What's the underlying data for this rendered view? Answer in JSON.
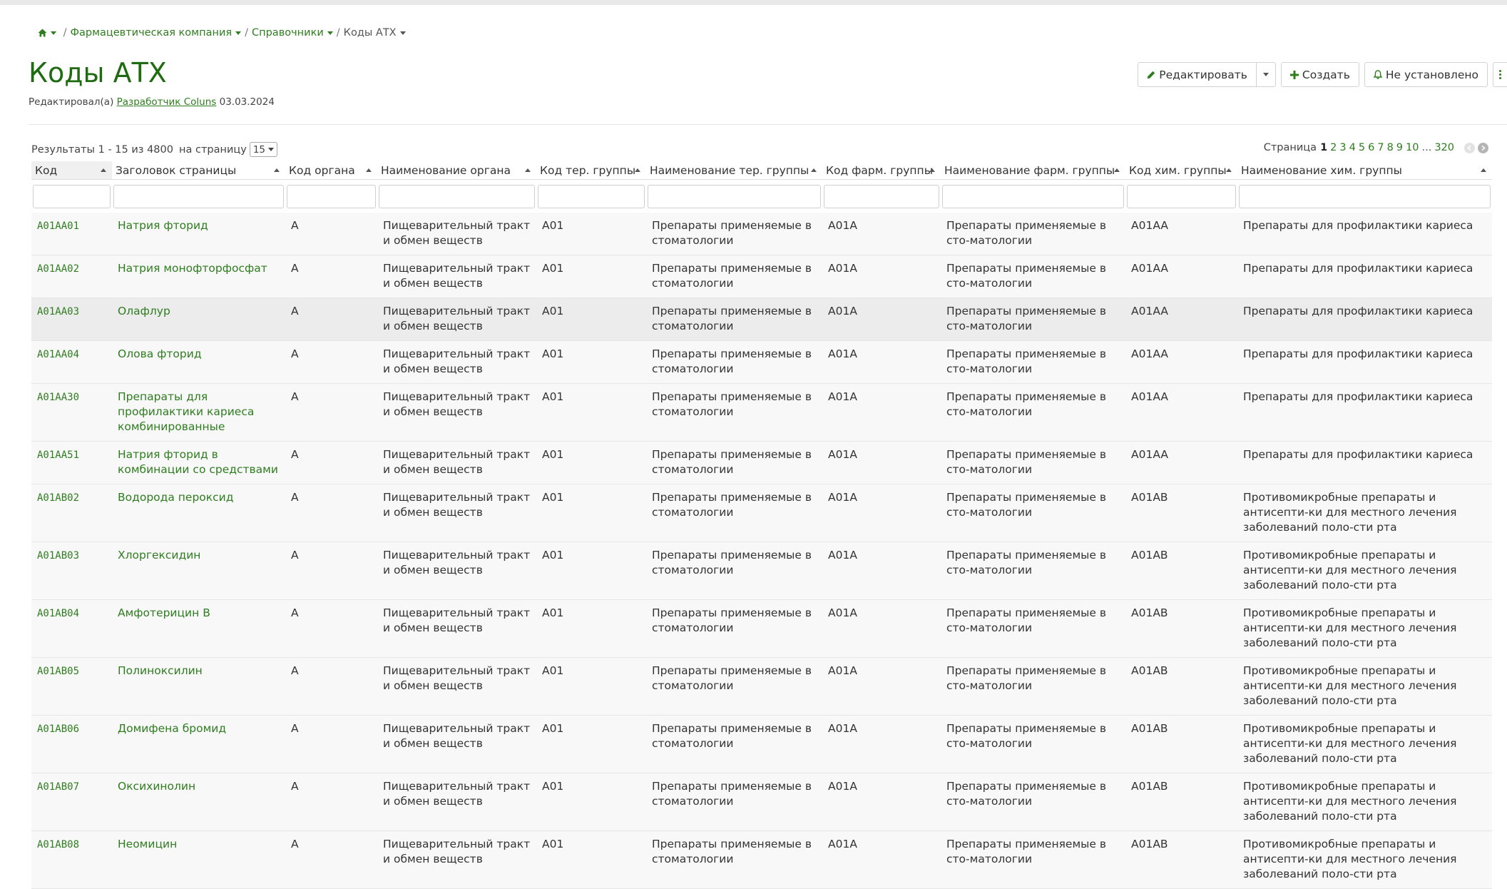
{
  "breadcrumb": {
    "items": [
      "Фармацевтическая компания",
      "Справочники"
    ],
    "current": "Коды АТХ",
    "separator": "/"
  },
  "page": {
    "title": "Коды АТХ",
    "edited_by_label": "Редактировал(а)",
    "edited_by_author": "Разработчик Coluns",
    "edited_date": "03.03.2024"
  },
  "actions": {
    "edit_label": "Редактировать",
    "create_label": "Создать",
    "notify_label": "Не установлено"
  },
  "results": {
    "summary": "Результаты 1 - 15 из 4800",
    "per_page_label": "на страницу",
    "per_page_value": "15"
  },
  "pagination": {
    "label": "Страница",
    "current": "1",
    "pages": [
      "2",
      "3",
      "4",
      "5",
      "6",
      "7",
      "8",
      "9",
      "10"
    ],
    "ellipsis": "...",
    "last": "320"
  },
  "table": {
    "columns": [
      "Код",
      "Заголовок страницы",
      "Код органа",
      "Наименование органа",
      "Код тер. группы",
      "Наименование тер. группы",
      "Код фарм. группы",
      "Наименование фарм. группы",
      "Код хим. группы",
      "Наименование хим. группы"
    ],
    "rows": [
      [
        "A01AA01",
        "Натрия фторид",
        "A",
        "Пищеварительный тракт и обмен веществ",
        "A01",
        "Препараты применяемые в стоматологии",
        "A01A",
        "Препараты применяемые в сто-матологии",
        "A01AA",
        "Препараты для профилактики кариеса"
      ],
      [
        "A01AA02",
        "Натрия монофторфосфат",
        "A",
        "Пищеварительный тракт и обмен веществ",
        "A01",
        "Препараты применяемые в стоматологии",
        "A01A",
        "Препараты применяемые в сто-матологии",
        "A01AA",
        "Препараты для профилактики кариеса"
      ],
      [
        "A01AA03",
        "Олафлур",
        "A",
        "Пищеварительный тракт и обмен веществ",
        "A01",
        "Препараты применяемые в стоматологии",
        "A01A",
        "Препараты применяемые в сто-матологии",
        "A01AA",
        "Препараты для профилактики кариеса"
      ],
      [
        "A01AA04",
        "Олова фторид",
        "A",
        "Пищеварительный тракт и обмен веществ",
        "A01",
        "Препараты применяемые в стоматологии",
        "A01A",
        "Препараты применяемые в сто-матологии",
        "A01AA",
        "Препараты для профилактики кариеса"
      ],
      [
        "A01AA30",
        "Препараты для профилактики кариеса комбинированные",
        "A",
        "Пищеварительный тракт и обмен веществ",
        "A01",
        "Препараты применяемые в стоматологии",
        "A01A",
        "Препараты применяемые в сто-матологии",
        "A01AA",
        "Препараты для профилактики кариеса"
      ],
      [
        "A01AA51",
        "Натрия фторид в комбинации со средствами",
        "A",
        "Пищеварительный тракт и обмен веществ",
        "A01",
        "Препараты применяемые в стоматологии",
        "A01A",
        "Препараты применяемые в сто-матологии",
        "A01AA",
        "Препараты для профилактики кариеса"
      ],
      [
        "A01AB02",
        "Водорода пероксид",
        "A",
        "Пищеварительный тракт и обмен веществ",
        "A01",
        "Препараты применяемые в стоматологии",
        "A01A",
        "Препараты применяемые в сто-матологии",
        "A01AB",
        "Противомикробные препараты и антисепти-ки для местного лечения заболеваний поло-сти рта"
      ],
      [
        "A01AB03",
        "Хлоргексидин",
        "A",
        "Пищеварительный тракт и обмен веществ",
        "A01",
        "Препараты применяемые в стоматологии",
        "A01A",
        "Препараты применяемые в сто-матологии",
        "A01AB",
        "Противомикробные препараты и антисепти-ки для местного лечения заболеваний поло-сти рта"
      ],
      [
        "A01AB04",
        "Амфотерицин B",
        "A",
        "Пищеварительный тракт и обмен веществ",
        "A01",
        "Препараты применяемые в стоматологии",
        "A01A",
        "Препараты применяемые в сто-матологии",
        "A01AB",
        "Противомикробные препараты и антисепти-ки для местного лечения заболеваний поло-сти рта"
      ],
      [
        "A01AB05",
        "Полиноксилин",
        "A",
        "Пищеварительный тракт и обмен веществ",
        "A01",
        "Препараты применяемые в стоматологии",
        "A01A",
        "Препараты применяемые в сто-матологии",
        "A01AB",
        "Противомикробные препараты и антисепти-ки для местного лечения заболеваний поло-сти рта"
      ],
      [
        "A01AB06",
        "Домифена бромид",
        "A",
        "Пищеварительный тракт и обмен веществ",
        "A01",
        "Препараты применяемые в стоматологии",
        "A01A",
        "Препараты применяемые в сто-матологии",
        "A01AB",
        "Противомикробные препараты и антисепти-ки для местного лечения заболеваний поло-сти рта"
      ],
      [
        "A01AB07",
        "Оксихинолин",
        "A",
        "Пищеварительный тракт и обмен веществ",
        "A01",
        "Препараты применяемые в стоматологии",
        "A01A",
        "Препараты применяемые в сто-матологии",
        "A01AB",
        "Противомикробные препараты и антисепти-ки для местного лечения заболеваний поло-сти рта"
      ],
      [
        "A01AB08",
        "Неомицин",
        "A",
        "Пищеварительный тракт и обмен веществ",
        "A01",
        "Препараты применяемые в стоматологии",
        "A01A",
        "Препараты применяемые в сто-матологии",
        "A01AB",
        "Противомикробные препараты и антисепти-ки для местного лечения заболеваний поло-сти рта"
      ]
    ]
  },
  "icons": {
    "home": "home-icon",
    "edit": "pencil-icon",
    "create": "plus-icon",
    "notify": "bell-icon",
    "more": "vertical-dots-icon"
  },
  "colors": {
    "accent": "#2e7d1f",
    "title": "#1f6b12",
    "row_background": "#f8f8f8",
    "row_highlight": "#ececec"
  }
}
